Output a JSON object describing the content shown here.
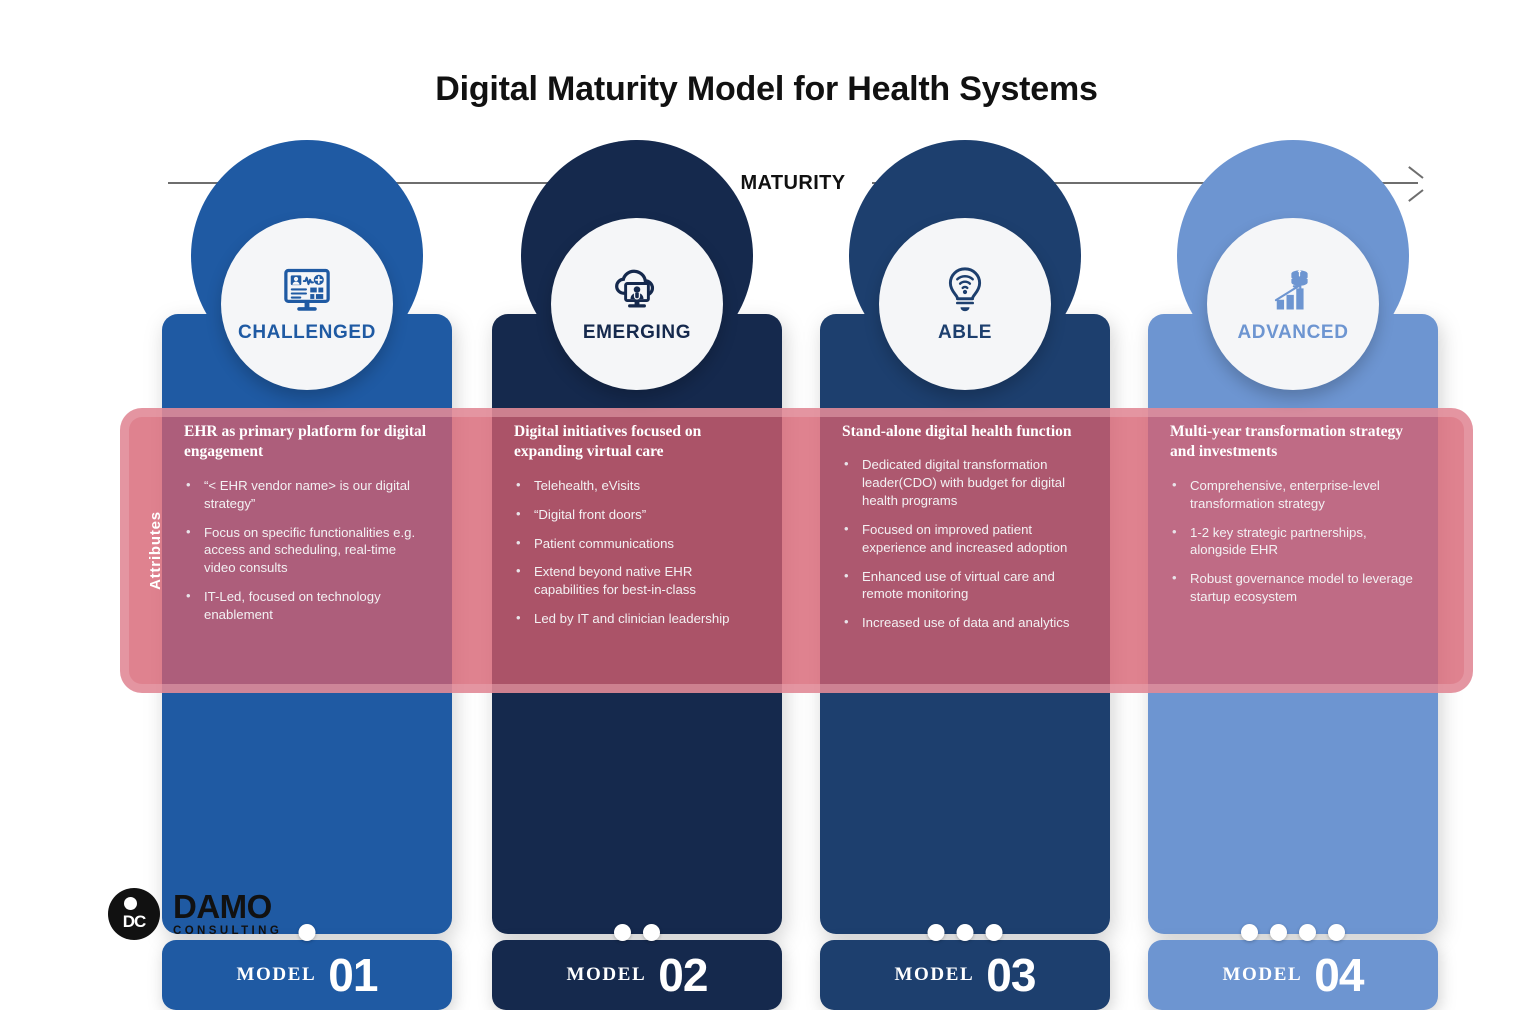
{
  "title": "Digital Maturity Model for Health Systems",
  "axis": {
    "label": "MATURITY"
  },
  "attributes_band": {
    "label": "Attributes"
  },
  "columns": [
    {
      "stage": "CHALLENGED",
      "icon": "ehr-monitor-icon",
      "color": "#1f5aa3",
      "dome_color": "#1f5aa3",
      "badge_text_color": "#1f5aa3",
      "model_word": "MODEL",
      "model_number": "01",
      "dots": 1,
      "heading": "EHR as primary platform for digital engagement",
      "bullets": [
        "“< EHR vendor name> is our digital strategy”",
        "Focus on specific functionalities e.g. access and scheduling, real-time video consults",
        "IT-Led, focused on technology enablement"
      ]
    },
    {
      "stage": "EMERGING",
      "icon": "cloud-telehealth-icon",
      "color": "#15294d",
      "dome_color": "#15294d",
      "badge_text_color": "#15294d",
      "model_word": "MODEL",
      "model_number": "02",
      "dots": 2,
      "heading": "Digital initiatives focused on expanding virtual care",
      "bullets": [
        "Telehealth, eVisits",
        "“Digital front doors”",
        "Patient communications",
        "Extend beyond native EHR capabilities for best-in-class",
        "Led by IT and clinician leadership"
      ]
    },
    {
      "stage": "ABLE",
      "icon": "lightbulb-wifi-icon",
      "color": "#1d3f6e",
      "dome_color": "#1d3f6e",
      "badge_text_color": "#1d3f6e",
      "model_word": "MODEL",
      "model_number": "03",
      "dots": 3,
      "heading": "Stand-alone digital health function",
      "bullets": [
        "Dedicated digital transformation leader(CDO) with budget for digital health programs",
        "Focused on improved patient experience and increased adoption",
        "Enhanced use of virtual care and remote monitoring",
        "Increased use of data and analytics"
      ]
    },
    {
      "stage": "ADVANCED",
      "icon": "growth-chart-coins-icon",
      "color": "#6d95d1",
      "dome_color": "#6d95d1",
      "badge_text_color": "#6d95d1",
      "model_word": "MODEL",
      "model_number": "04",
      "dots": 4,
      "heading": "Multi-year transformation strategy and investments",
      "bullets": [
        "Comprehensive, enterprise-level transformation strategy",
        "1-2 key strategic partnerships, alongside EHR",
        "Robust governance model to leverage startup ecosystem"
      ]
    }
  ],
  "logo": {
    "name": "DAMO",
    "subtitle": "CONSULTING",
    "monogram": "DC"
  },
  "palette": {
    "attributes_band": "#d65f70",
    "attributes_band_border": "#e9a5b0",
    "badge_bg": "#f5f6f8",
    "title_color": "#111111",
    "axis_color": "#6e6e6e"
  }
}
